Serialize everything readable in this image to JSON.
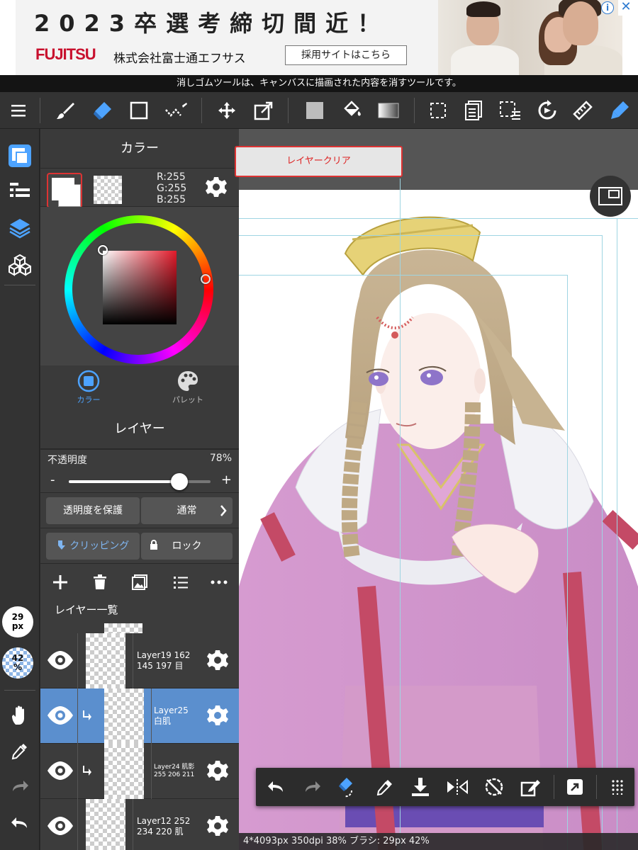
{
  "ad": {
    "headline": "2023卒選考締切間近！",
    "brand": "FUJITSU",
    "company": "株式会社富士通エフサス",
    "cta": "採用サイトはこちら",
    "info_icon": "info-icon",
    "close_icon": "close-icon"
  },
  "tooltip": "消しゴムツールは、キャンバスに描画された内容を消すツールです。",
  "toolbar": {
    "tools": [
      "menu-icon",
      "brush-icon",
      "eraser-icon",
      "rectangle-icon",
      "line-tool-icon",
      "move-icon",
      "transform-icon",
      "fill-color-icon",
      "bucket-icon",
      "gradient-icon",
      "select-icon",
      "layer-properties-icon",
      "select-menu-icon",
      "rotate-icon",
      "ruler-icon",
      "pen-icon"
    ],
    "active": "eraser-icon",
    "accent": "#4da3ff"
  },
  "rail": {
    "brush_size_value": "29",
    "brush_size_unit": "px",
    "zoom_value": "42",
    "zoom_unit": "%"
  },
  "color_panel": {
    "title": "カラー",
    "r": "R:255",
    "g": "G:255",
    "b": "B:255",
    "tab_color": "カラー",
    "tab_palette": "パレット"
  },
  "clear_button": "レイヤークリア",
  "layer_panel": {
    "title": "レイヤー",
    "opacity_label": "不透明度",
    "opacity_value": "78%",
    "opacity_fraction": 0.78,
    "minus": "-",
    "plus": "+",
    "protect_alpha": "透明度を保護",
    "blend_mode": "通常",
    "clipping": "クリッピング",
    "lock": "ロック",
    "list_title": "レイヤー一覧",
    "layers": [
      {
        "line1": "Layer19 162",
        "line2": "145 197 目",
        "selected": false,
        "clip": false
      },
      {
        "line1": "Layer25",
        "line2": "白肌",
        "selected": true,
        "clip": true
      },
      {
        "line1": "Layer24 肌影",
        "line2": "255 206 211",
        "selected": false,
        "clip": true
      },
      {
        "line1": "Layer12 252",
        "line2": "234 220 肌",
        "selected": false,
        "clip": false
      }
    ]
  },
  "status": "4*4093px 350dpi 38% ブラシ: 29px 42%"
}
